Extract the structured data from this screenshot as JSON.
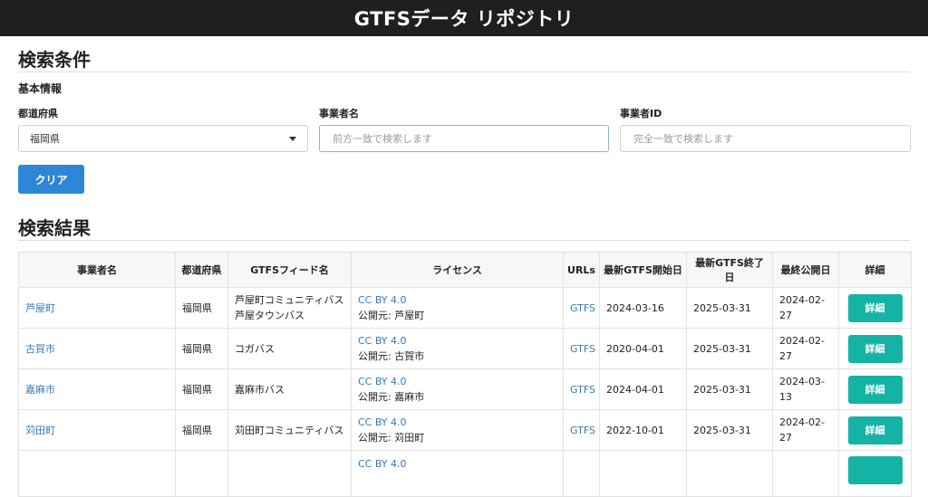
{
  "header": {
    "title": "GTFSデータ リポジトリ"
  },
  "search": {
    "title": "検索条件",
    "subtitle": "基本情報",
    "prefecture_label": "都道府県",
    "prefecture_value": "福岡県",
    "operator_name_label": "事業者名",
    "operator_name_placeholder": "前方一致で検索します",
    "operator_id_label": "事業者ID",
    "operator_id_placeholder": "完全一致で検索します",
    "clear_label": "クリア"
  },
  "results": {
    "title": "検索結果",
    "columns": [
      "事業者名",
      "都道府県",
      "GTFSフィード名",
      "ライセンス",
      "URLs",
      "最新GTFS開始日",
      "最新GTFS終了日",
      "最終公開日",
      "詳細"
    ],
    "rows": [
      {
        "operator": "芦屋町",
        "prefecture": "福岡県",
        "feed_lines": [
          "芦屋町コミュニティバス",
          "芦屋タウンバス"
        ],
        "license": "CC BY 4.0",
        "publisher": "公開元: 芦屋町",
        "url": "GTFS",
        "start": "2024-03-16",
        "end": "2025-03-31",
        "published": "2024-02-27",
        "detail": "詳細"
      },
      {
        "operator": "古賀市",
        "prefecture": "福岡県",
        "feed_lines": [
          "コガバス"
        ],
        "license": "CC BY 4.0",
        "publisher": "公開元: 古賀市",
        "url": "GTFS",
        "start": "2020-04-01",
        "end": "2025-03-31",
        "published": "2024-02-27",
        "detail": "詳細"
      },
      {
        "operator": "嘉麻市",
        "prefecture": "福岡県",
        "feed_lines": [
          "嘉麻市バス"
        ],
        "license": "CC BY 4.0",
        "publisher": "公開元: 嘉麻市",
        "url": "GTFS",
        "start": "2024-04-01",
        "end": "2025-03-31",
        "published": "2024-03-13",
        "detail": "詳細"
      },
      {
        "operator": "苅田町",
        "prefecture": "福岡県",
        "feed_lines": [
          "苅田町コミュニティバス"
        ],
        "license": "CC BY 4.0",
        "publisher": "公開元: 苅田町",
        "url": "GTFS",
        "start": "2022-10-01",
        "end": "2025-03-31",
        "published": "2024-02-27",
        "detail": "詳細"
      },
      {
        "operator": "",
        "prefecture": "",
        "feed_lines": [
          ""
        ],
        "license": "CC BY 4.0",
        "publisher": "",
        "url": "",
        "start": "",
        "end": "",
        "published": "",
        "detail": ""
      }
    ]
  }
}
